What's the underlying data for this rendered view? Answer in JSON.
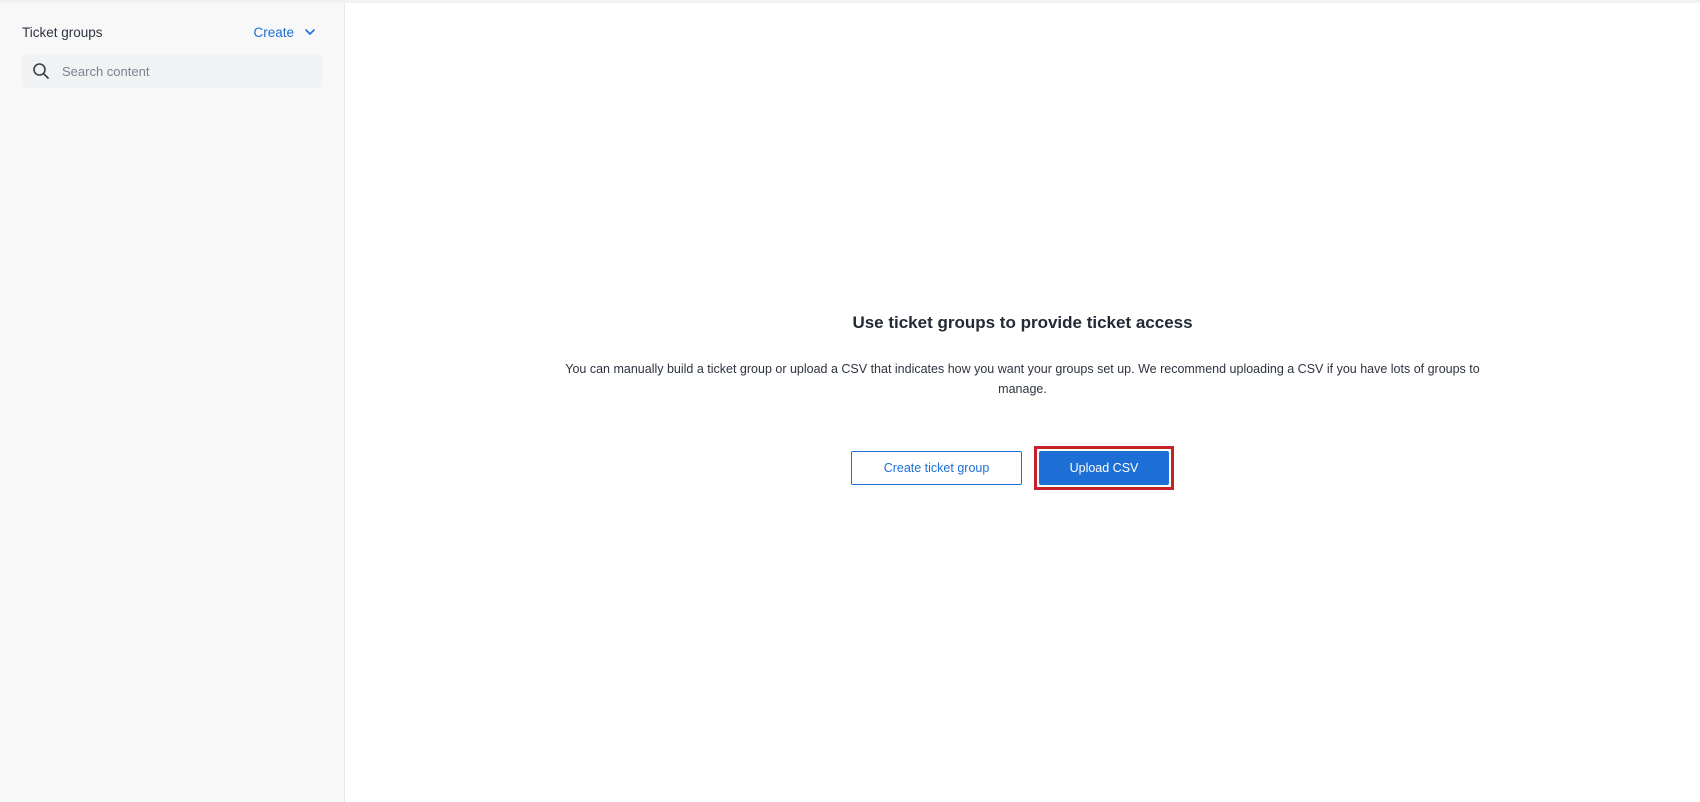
{
  "sidebar": {
    "title": "Ticket groups",
    "create_label": "Create",
    "search": {
      "placeholder": "Search content",
      "value": ""
    }
  },
  "main": {
    "empty_state": {
      "title": "Use ticket groups to provide ticket access",
      "description": "You can manually build a ticket group or upload a CSV that indicates how you want your groups set up. We recommend uploading a CSV if you have lots of groups to manage.",
      "create_button_label": "Create ticket group",
      "upload_button_label": "Upload CSV"
    }
  },
  "colors": {
    "accent": "#1d6fd6",
    "highlight": "#c8202a",
    "sidebar_bg": "#f8f8f9"
  },
  "icons": {
    "search": "search-icon",
    "create_dropdown": "chevron-down-icon"
  }
}
